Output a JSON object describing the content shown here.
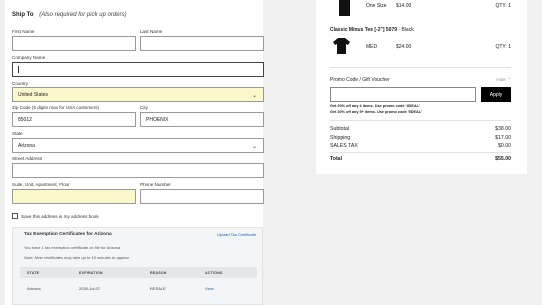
{
  "form": {
    "ship_to_label": "Ship To",
    "ship_to_note": "(Also required for pick up orders)",
    "first_name_label": "First Name",
    "first_name_value": "",
    "last_name_label": "Last Name",
    "last_name_value": "",
    "company_label": "Company Name",
    "company_value": "",
    "country_label": "Country",
    "country_value": "United States",
    "zip_label": "Zip Code (5 digits max for USA customers)",
    "zip_value": "85012",
    "city_label": "City",
    "city_value": "PHOENIX",
    "state_label": "State",
    "state_value": "Arizona",
    "street_label": "Street Address",
    "street_value": "",
    "suite_label": "Suite, Unit, Apartment, Floor",
    "suite_value": "",
    "phone_label": "Phone Number",
    "phone_value": "",
    "save_address_label": "Save this address in my address book",
    "save_address_checked": false
  },
  "tax": {
    "title": "Tax Exemption Certificates for Arizona",
    "upload_link": "Upload Tax Certificate",
    "info": "You have 1 tax exemption certificate on file for Arizona",
    "note": "Note: New certificates may take up to 15 minutes to appear.",
    "columns": [
      "STATE",
      "EXPIRATION",
      "REASON",
      "ACTIONS"
    ],
    "rows": [
      {
        "state": "Arizona",
        "expiration": "2026-Jul-07",
        "reason": "RESALE",
        "action": "View"
      }
    ]
  },
  "cart": {
    "items": [
      {
        "name": "",
        "variant": "",
        "size": "One Size",
        "price": "$14.00",
        "qty": "QTY: 1",
        "thumb_color": "#111111"
      },
      {
        "name": "Classic Minus Tee [-2\"] 5079",
        "variant": "- Black",
        "size": "MED",
        "price": "$24.00",
        "qty": "QTY: 1",
        "thumb_color": "#111111"
      }
    ],
    "promo_title": "Promo Code / Gift Voucher",
    "promo_hide": "Hide",
    "promo_value": "",
    "apply_label": "Apply",
    "promo_notes": [
      "Get 20% off any 4 items. Use promo code '4DEAL'",
      "Get 20% off any 5+ items. Use promo code '5DEAL'"
    ],
    "summary": {
      "subtotal_label": "Subtotal",
      "subtotal": "$38.00",
      "shipping_label": "Shipping",
      "shipping": "$17.00",
      "tax_label": "SALES TAX",
      "tax": "$0.00",
      "total_label": "Total",
      "total": "$55.00"
    }
  },
  "colors": {
    "autofill_yellow": "#fbf8cc",
    "link_blue": "#1f5fad",
    "apply_button": "#000000"
  },
  "icons": {
    "dropdown": "chevron-down-icon",
    "promo_toggle": "chevron-up-icon"
  }
}
